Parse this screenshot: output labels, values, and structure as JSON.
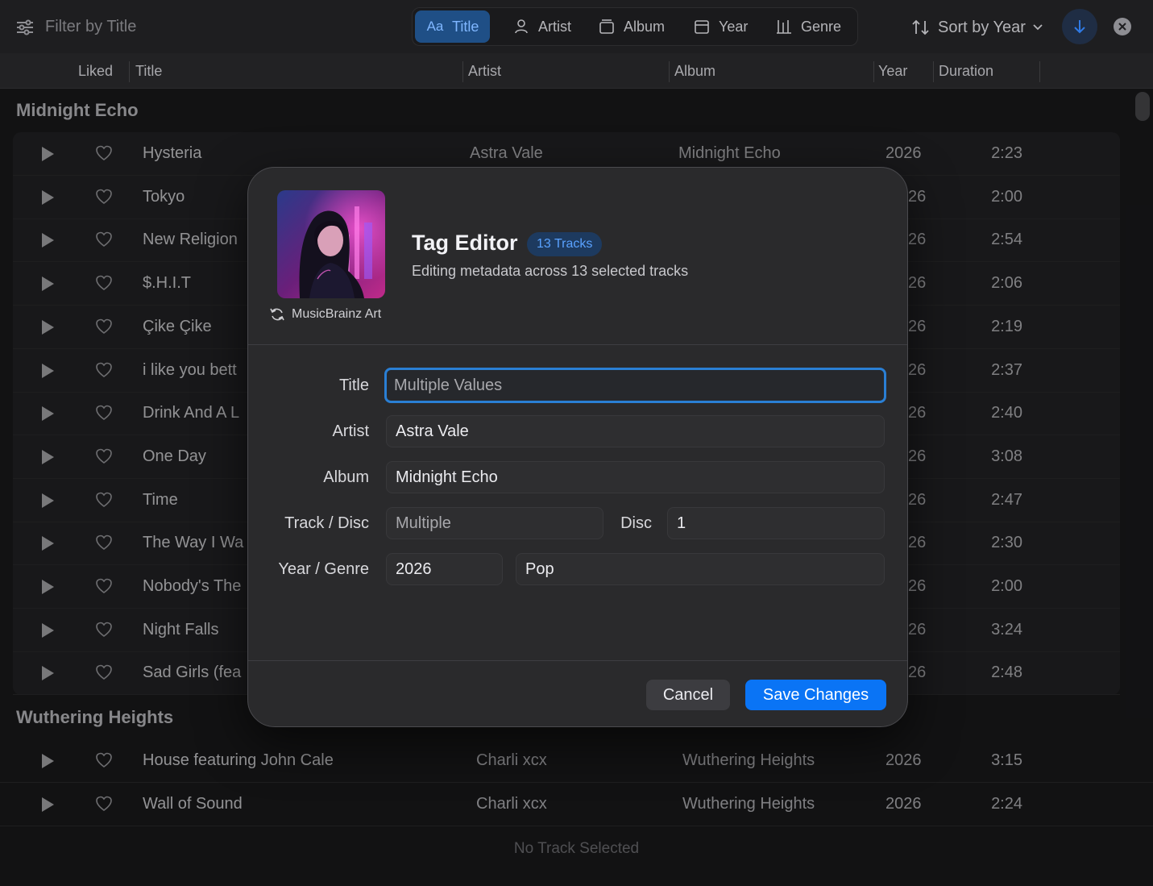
{
  "toolbar": {
    "filter_placeholder": "Filter by Title",
    "segments": [
      {
        "label": "Title",
        "icon": "Aa",
        "active": true
      },
      {
        "label": "Artist",
        "icon": "person-icon",
        "active": false
      },
      {
        "label": "Album",
        "icon": "album-icon",
        "active": false
      },
      {
        "label": "Year",
        "icon": "calendar-icon",
        "active": false
      },
      {
        "label": "Genre",
        "icon": "genre-icon",
        "active": false
      }
    ],
    "sort_label": "Sort by Year"
  },
  "columns": {
    "liked": "Liked",
    "title": "Title",
    "artist": "Artist",
    "album": "Album",
    "year": "Year",
    "duration": "Duration"
  },
  "groups": [
    {
      "name": "Midnight Echo",
      "tracks": [
        {
          "title": "Hysteria",
          "artist": "Astra Vale",
          "album": "Midnight Echo",
          "year": "2026",
          "duration": "2:23"
        },
        {
          "title": "Tokyo",
          "artist": "",
          "album": "",
          "year": "26",
          "duration": "2:00"
        },
        {
          "title": "New Religion",
          "artist": "",
          "album": "",
          "year": "26",
          "duration": "2:54"
        },
        {
          "title": "$.H.I.T",
          "artist": "",
          "album": "",
          "year": "26",
          "duration": "2:06"
        },
        {
          "title": "Çike Çike",
          "artist": "",
          "album": "",
          "year": "26",
          "duration": "2:19"
        },
        {
          "title": "i like you bett",
          "artist": "",
          "album": "",
          "year": "26",
          "duration": "2:37"
        },
        {
          "title": "Drink And A L",
          "artist": "",
          "album": "",
          "year": "26",
          "duration": "2:40"
        },
        {
          "title": "One Day",
          "artist": "",
          "album": "",
          "year": "26",
          "duration": "3:08"
        },
        {
          "title": "Time",
          "artist": "",
          "album": "",
          "year": "26",
          "duration": "2:47"
        },
        {
          "title": "The Way I Wa",
          "artist": "",
          "album": "",
          "year": "26",
          "duration": "2:30"
        },
        {
          "title": "Nobody's The",
          "artist": "",
          "album": "",
          "year": "26",
          "duration": "2:00"
        },
        {
          "title": "Night Falls",
          "artist": "",
          "album": "",
          "year": "26",
          "duration": "3:24"
        },
        {
          "title": "Sad Girls (fea",
          "artist": "",
          "album": "",
          "year": "26",
          "duration": "2:48"
        }
      ]
    },
    {
      "name": "Wuthering Heights",
      "tracks": [
        {
          "title": "House featuring John Cale",
          "artist": "Charli xcx",
          "album": "Wuthering Heights",
          "year": "2026",
          "duration": "3:15"
        },
        {
          "title": "Wall of Sound",
          "artist": "Charli xcx",
          "album": "Wuthering Heights",
          "year": "2026",
          "duration": "2:24"
        }
      ]
    }
  ],
  "status": "No Track Selected",
  "dialog": {
    "title": "Tag Editor",
    "badge": "13 Tracks",
    "subtitle": "Editing metadata across 13 selected tracks",
    "art_caption": "MusicBrainz Art",
    "labels": {
      "title": "Title",
      "artist": "Artist",
      "album": "Album",
      "track_disc": "Track / Disc",
      "disc": "Disc",
      "year_genre": "Year / Genre"
    },
    "fields": {
      "title_placeholder": "Multiple Values",
      "artist_value": "Astra Vale",
      "album_value": "Midnight Echo",
      "track_placeholder": "Multiple",
      "disc_value": "1",
      "year_value": "2026",
      "genre_value": "Pop"
    },
    "cancel_label": "Cancel",
    "save_label": "Save Changes"
  },
  "colors": {
    "accent": "#0a74f5",
    "focus_ring": "#2a7fd4",
    "badge_text": "#5aa2ff",
    "background": "#1c1c1e"
  }
}
